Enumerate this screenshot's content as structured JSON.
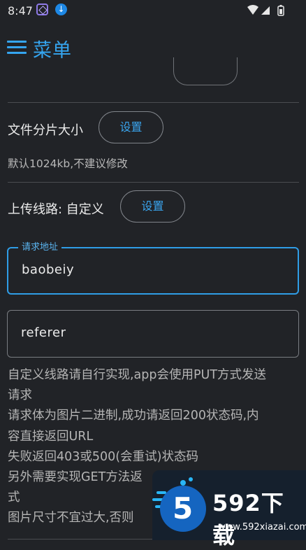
{
  "status_bar": {
    "time": "8:47"
  },
  "header": {
    "title": "菜单"
  },
  "file_split": {
    "label": "文件分片大小",
    "button": "设置",
    "hint": "默认1024kb,不建议修改"
  },
  "upload_route": {
    "label": "上传线路: 自定义",
    "button": "设置"
  },
  "request_url_field": {
    "label": "请求地址",
    "value": "baobeiy"
  },
  "referer_field": {
    "value": "referer"
  },
  "description_lines": [
    "自定义线路请自行实现,app会使用PUT方式发送",
    "请求",
    "请求体为图片二进制,成功请返回200状态码,内",
    "容直接返回URL",
    "失败返回403或500(会重试)状态码",
    "另外需要实现GET方法返",
    "式",
    "图片尺寸不宜过大,否则"
  ],
  "watermark": {
    "logo_num": "5",
    "brand": "592下载",
    "url": "www.592xiazai.com"
  },
  "colors": {
    "background": "#212327",
    "accent": "#35a5f0",
    "text": "#ececec"
  }
}
